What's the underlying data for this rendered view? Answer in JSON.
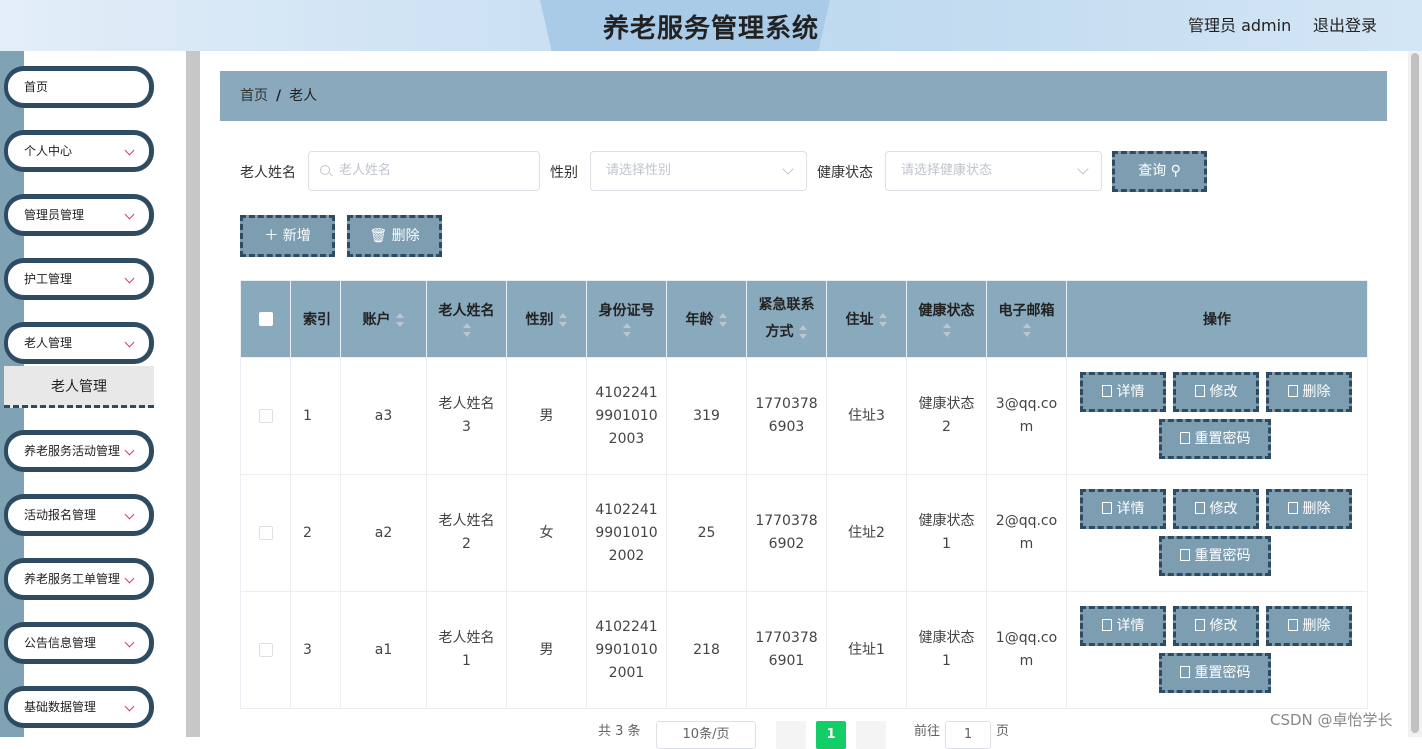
{
  "header": {
    "title": "养老服务管理系统",
    "user": "管理员 admin",
    "logout": "退出登录"
  },
  "sidebar": {
    "items": [
      {
        "label": "首页",
        "chevron": false
      },
      {
        "label": "个人中心",
        "chevron": true
      },
      {
        "label": "管理员管理",
        "chevron": true
      },
      {
        "label": "护工管理",
        "chevron": true
      },
      {
        "label": "老人管理",
        "chevron": true
      },
      {
        "label": "养老服务活动管理",
        "chevron": true
      },
      {
        "label": "活动报名管理",
        "chevron": true
      },
      {
        "label": "养老服务工单管理",
        "chevron": true
      },
      {
        "label": "公告信息管理",
        "chevron": true
      },
      {
        "label": "基础数据管理",
        "chevron": true
      }
    ],
    "active_sub": "老人管理"
  },
  "breadcrumb": {
    "home": "首页",
    "sep": "/",
    "current": "老人"
  },
  "search": {
    "name_label": "老人姓名",
    "name_placeholder": "老人姓名",
    "gender_label": "性别",
    "gender_placeholder": "请选择性别",
    "health_label": "健康状态",
    "health_placeholder": "请选择健康状态",
    "query_button": "查询 ⚲"
  },
  "actions": {
    "add": "＋ 新增",
    "delete": "🗑 删除"
  },
  "table": {
    "headers": {
      "index": "索引",
      "account": "账户",
      "name": "老人姓名",
      "gender": "性别",
      "idcard": "身份证号",
      "age": "年龄",
      "phone": "紧急联系方式",
      "address": "住址",
      "health": "健康状态",
      "email": "电子邮箱",
      "ops": "操作"
    },
    "rows": [
      {
        "index": "1",
        "account": "a3",
        "name": "老人姓名3",
        "gender": "男",
        "idcard": "410224199010102003",
        "age": "319",
        "phone": "17703786903",
        "address": "住址3",
        "health": "健康状态2",
        "email": "3@qq.com"
      },
      {
        "index": "2",
        "account": "a2",
        "name": "老人姓名2",
        "gender": "女",
        "idcard": "410224199010102002",
        "age": "25",
        "phone": "17703786902",
        "address": "住址2",
        "health": "健康状态1",
        "email": "2@qq.com"
      },
      {
        "index": "3",
        "account": "a1",
        "name": "老人姓名1",
        "gender": "男",
        "idcard": "410224199010102001",
        "age": "218",
        "phone": "17703786901",
        "address": "住址1",
        "health": "健康状态1",
        "email": "1@qq.com"
      }
    ],
    "op_labels": {
      "detail": "详情",
      "edit": "修改",
      "delete": "删除",
      "reset": "重置密码"
    }
  },
  "pagination": {
    "total": "共 3 条",
    "page_size": "10条/页",
    "current": "1",
    "goto_label": "前往",
    "goto_value": "1",
    "page_suffix": "页"
  },
  "watermark": "CSDN @卓怡学长"
}
